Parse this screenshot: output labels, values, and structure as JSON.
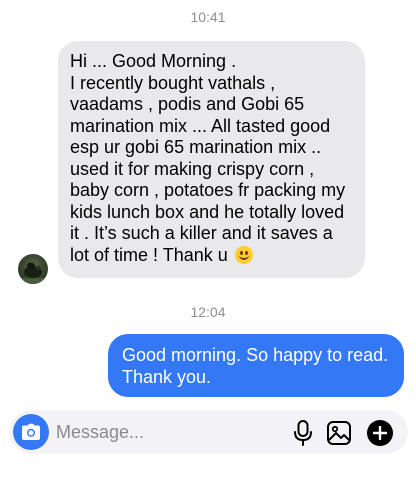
{
  "conversation": {
    "timestamp_1": "10:41",
    "incoming_message": {
      "lines": [
        "Hi ... Good Morning .",
        "I recently bought vathals ,",
        "vaadams , podis and Gobi 65",
        "marination mix ... All tasted good",
        "esp ur gobi 65 marination mix ..",
        "used it for making  crispy corn ,",
        "baby corn , potatoes fr packing my",
        "kids lunch box and he totally loved",
        "it . It’s such a killer and it saves a",
        "lot of time ! Thank u"
      ],
      "emoji": "smiling-face-emoji"
    },
    "timestamp_2": "12:04",
    "outgoing_message": {
      "lines": [
        "Good morning. So happy to read.",
        "Thank you."
      ]
    }
  },
  "composer": {
    "placeholder": "Message...",
    "icons": [
      "camera-icon",
      "microphone-icon",
      "gallery-icon",
      "plus-icon"
    ]
  },
  "colors": {
    "accent": "#3478f6",
    "incoming_bubble": "#e9e9eb",
    "timestamp": "#8e8e93"
  }
}
